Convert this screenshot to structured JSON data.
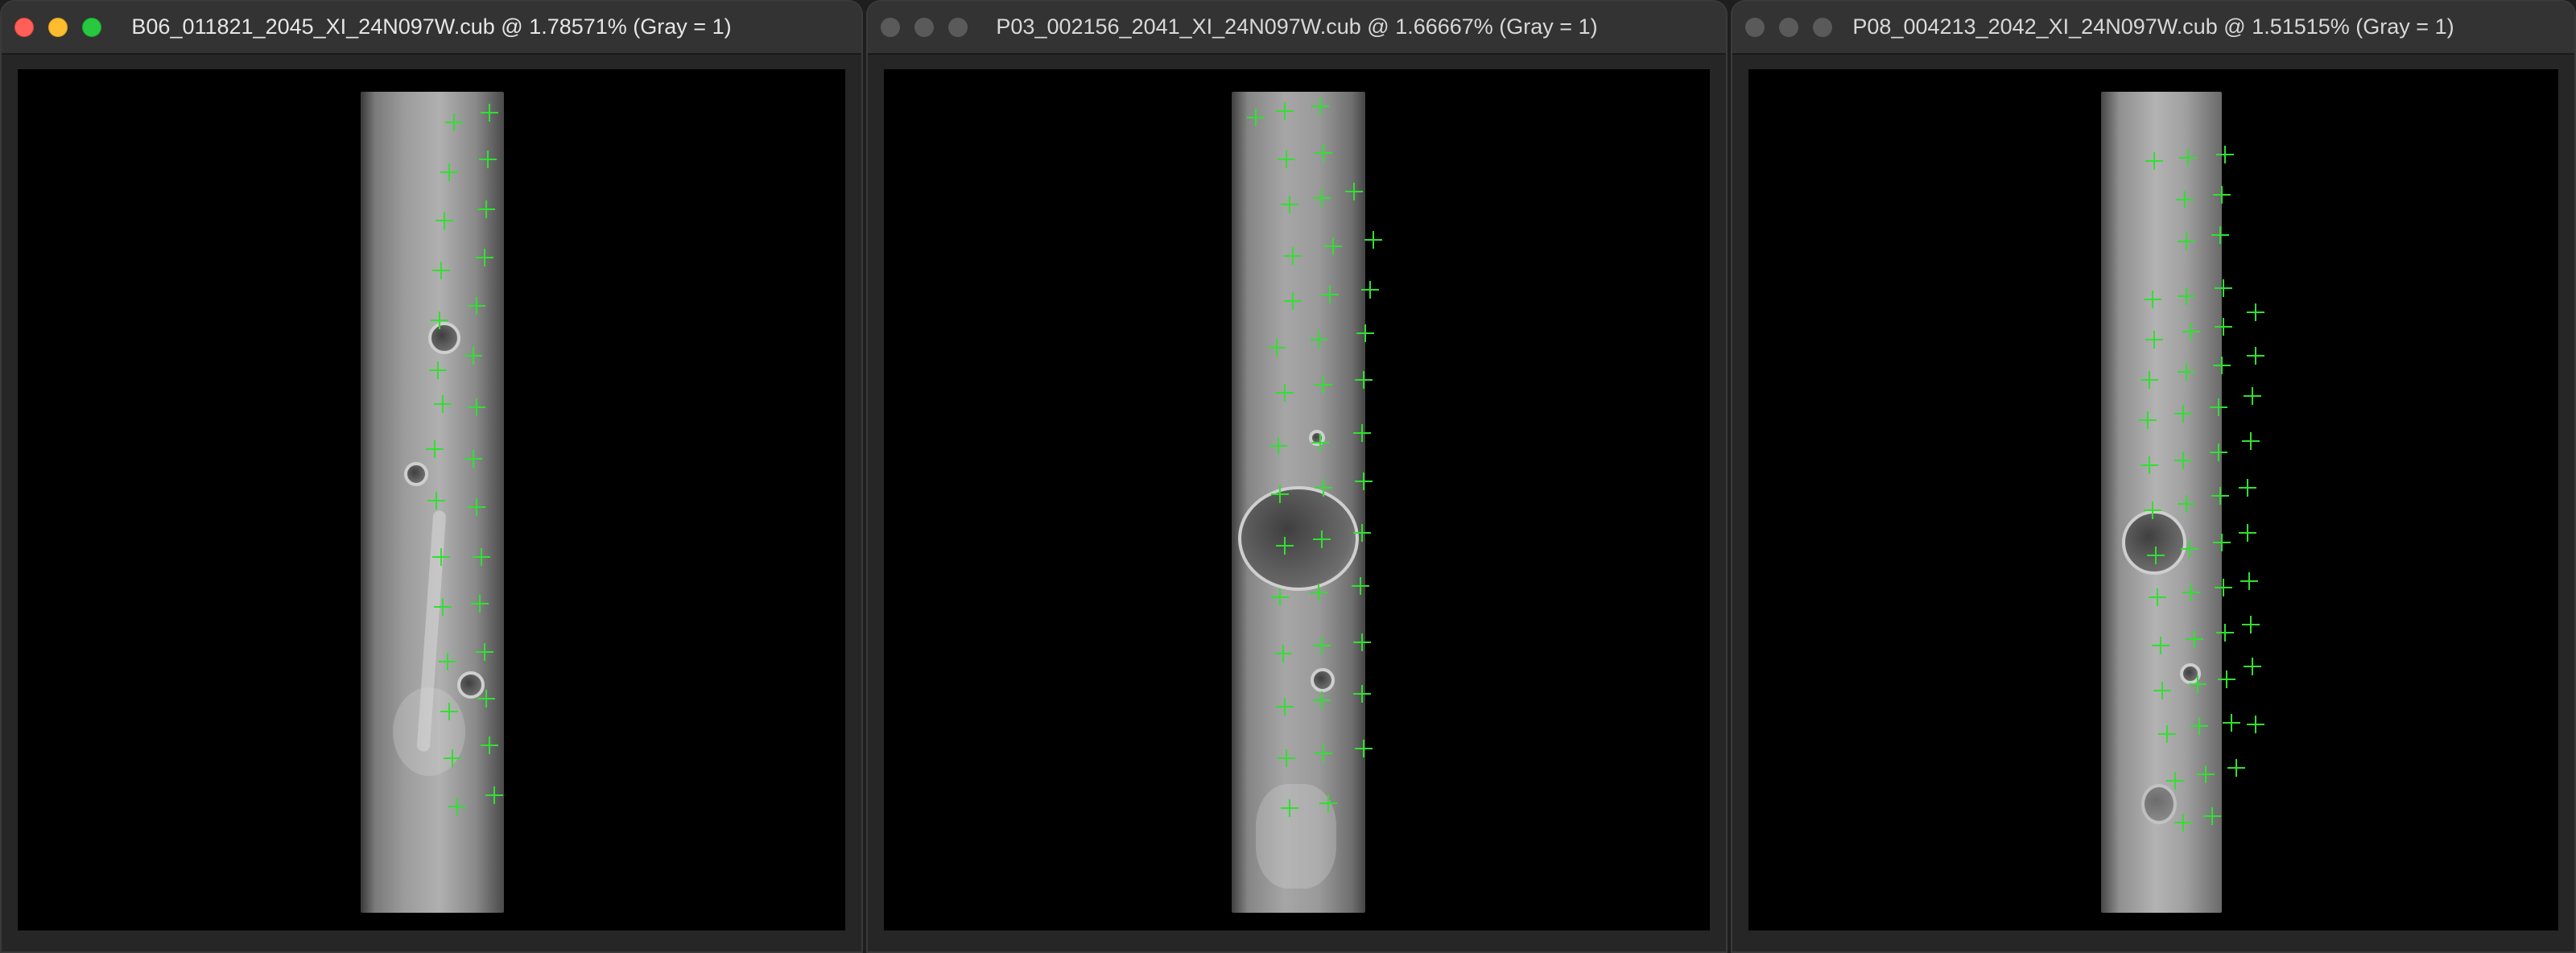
{
  "windows": [
    {
      "id": "w1",
      "title": "B06_011821_2045_XI_24N097W.cub @ 1.78571% (Gray = 1)",
      "active": true
    },
    {
      "id": "w2",
      "title": "P03_002156_2041_XI_24N097W.cub @ 1.66667% (Gray = 1)",
      "active": false
    },
    {
      "id": "w3",
      "title": "P08_004213_2042_XI_24N097W.cub @ 1.51515% (Gray = 1)",
      "active": false
    }
  ],
  "colors": {
    "marker": "#30e030",
    "close": "#ff5f57",
    "minimize": "#febc2e",
    "zoom": "#28c840"
  },
  "icons": [
    "close-button-icon",
    "minimize-button-icon",
    "zoom-button-icon",
    "control-point-cross-icon"
  ]
}
